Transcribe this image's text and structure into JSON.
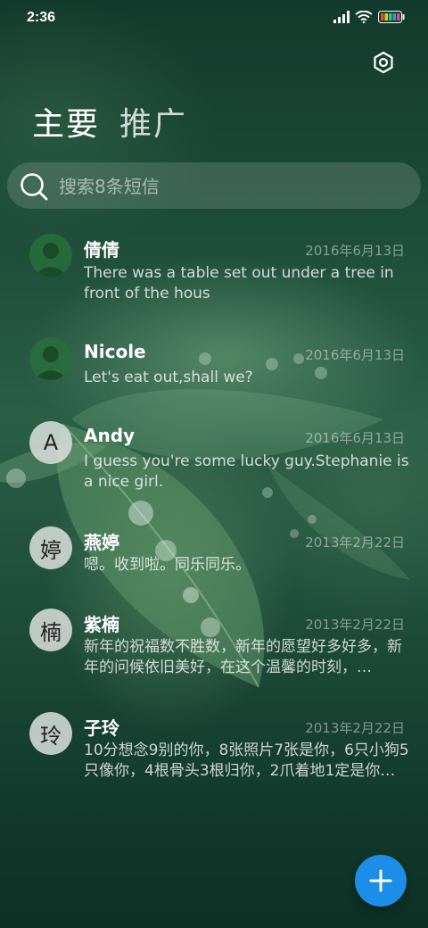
{
  "status_bar": {
    "time": "2:36",
    "icons": [
      "signal-icon",
      "wifi-icon",
      "battery-icon"
    ]
  },
  "header": {
    "tabs": [
      {
        "label": "主要",
        "active": true
      },
      {
        "label": "推广",
        "active": false
      }
    ],
    "settings_icon": "gear-icon"
  },
  "search": {
    "placeholder": "搜索8条短信",
    "value": ""
  },
  "conversations": [
    {
      "name": "倩倩",
      "date": "2016年6月13日",
      "avatar": "person-icon",
      "preview": "There was a table set out under a tree in front of the hous"
    },
    {
      "name": "Nicole",
      "date": "2016年6月13日",
      "avatar": "person-icon",
      "preview": "Let's eat out,shall we?"
    },
    {
      "name": "Andy",
      "date": "2016年6月13日",
      "avatar_letter": "A",
      "preview": "I guess you're some lucky guy.Stephanie is a nice girl."
    },
    {
      "name": "燕婷",
      "date": "2013年2月22日",
      "avatar_letter": "婷",
      "preview": "嗯。收到啦。同乐同乐。"
    },
    {
      "name": "紫楠",
      "date": "2013年2月22日",
      "avatar_letter": "楠",
      "preview": "新年的祝福数不胜数，新年的愿望好多好多，新年的问候依旧美好，在这个温馨的时刻，…"
    },
    {
      "name": "子玲",
      "date": "2013年2月22日",
      "avatar_letter": "玲",
      "preview": "10分想念9别的你，8张照片7张是你，6只小狗5只像你，4根骨头3根归你，2爪着地1定是你…"
    }
  ],
  "fab": {
    "icon": "plus-icon",
    "color": "#1d8ee8"
  },
  "colors": {
    "accent": "#1d8ee8",
    "background": "#1d4d39"
  }
}
